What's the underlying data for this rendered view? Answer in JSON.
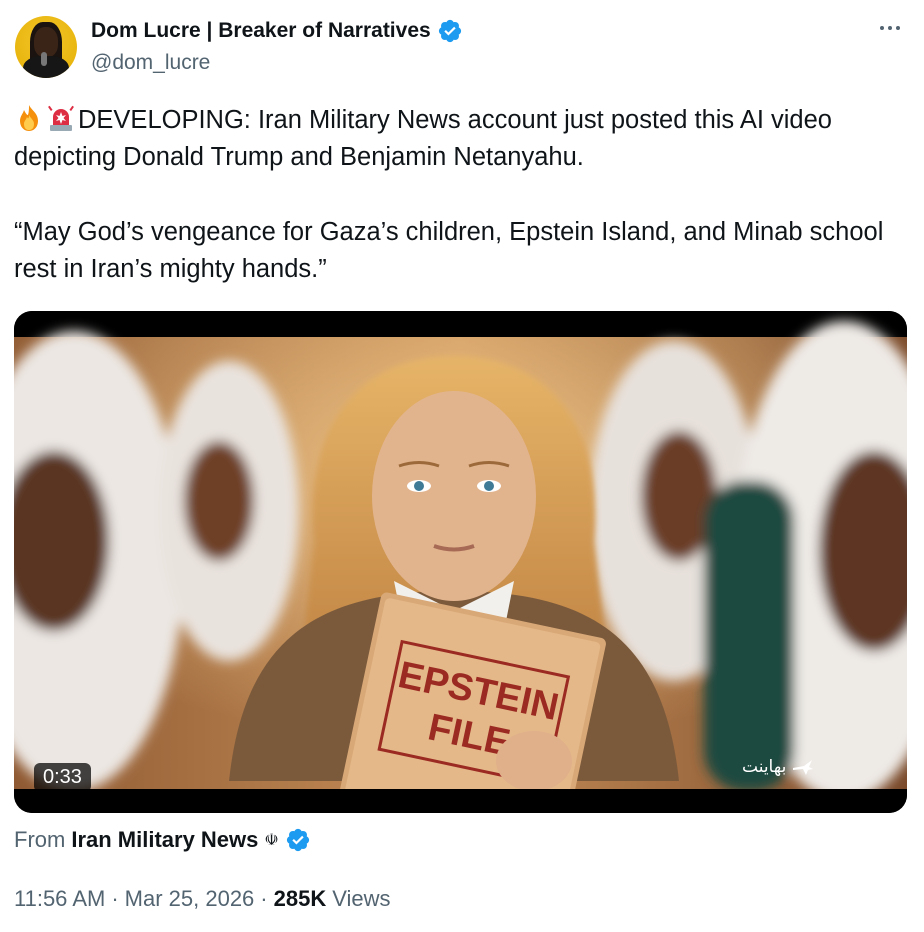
{
  "author": {
    "display_name": "Dom Lucre | Breaker of Narratives",
    "handle": "@dom_lucre",
    "verified": true
  },
  "tweet": {
    "emojis": [
      "fire-emoji",
      "rotating-light-emoji"
    ],
    "paragraph_1": "DEVELOPING: Iran Military News account just posted this AI video depicting Donald Trump and Benjamin Netanyahu.",
    "paragraph_2": "“May God’s vengeance for Gaza’s children, Epstein Island, and Minab school rest in Iran’s mighty hands.”"
  },
  "media": {
    "type": "video",
    "duration": "0:33",
    "folder_text_line1": "EPSTEIN",
    "folder_text_line2": "FILE",
    "watermark": "بهاينت"
  },
  "source": {
    "from_label": "From",
    "account": "Iran Military News",
    "flag_glyph": "☫",
    "verified": true
  },
  "meta": {
    "time": "11:56 AM",
    "separator": "·",
    "date": "Mar 25, 2026",
    "views_count": "285K",
    "views_label": "Views"
  },
  "colors": {
    "verified_blue": "#1d9bf0",
    "text_primary": "#0f1419",
    "text_secondary": "#536471"
  }
}
